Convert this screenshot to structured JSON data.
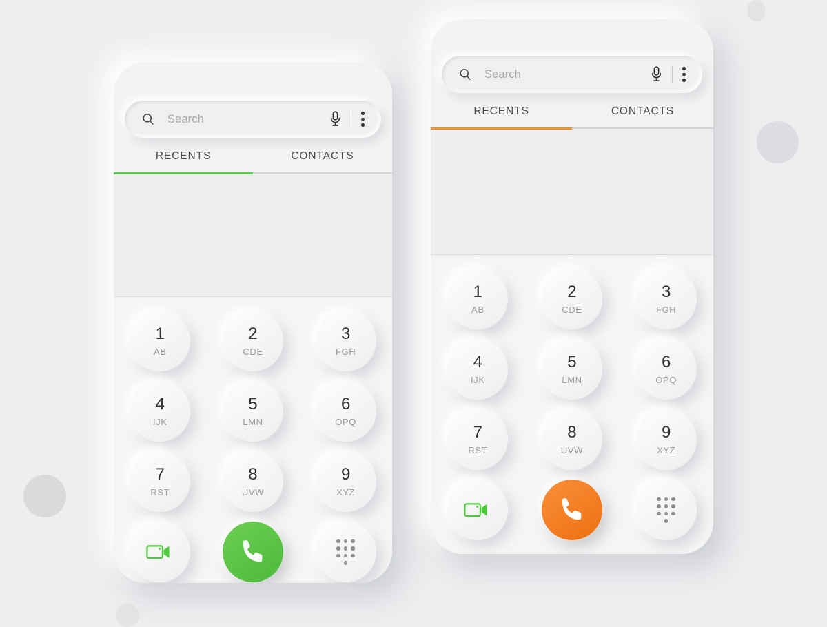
{
  "background": {
    "page_color": "#edeef0",
    "decorations": [
      "circle-top-right",
      "circle-right",
      "circle-bottom-left",
      "circle-bottom"
    ]
  },
  "panels": [
    {
      "id": "left",
      "accent_color": "#5bc74a",
      "call_button_color": "#5bc74a",
      "search": {
        "placeholder": "Search",
        "search_icon": "search-icon",
        "mic_icon": "microphone-icon",
        "menu_icon": "overflow-menu-icon"
      },
      "tabs": [
        {
          "label": "RECENTS",
          "active": true
        },
        {
          "label": "CONTACTS",
          "active": false
        }
      ],
      "keypad": [
        {
          "num": "1",
          "letters": "AB"
        },
        {
          "num": "2",
          "letters": "CDE"
        },
        {
          "num": "3",
          "letters": "FGH"
        },
        {
          "num": "4",
          "letters": "IJK"
        },
        {
          "num": "5",
          "letters": "LMN"
        },
        {
          "num": "6",
          "letters": "OPQ"
        },
        {
          "num": "7",
          "letters": "RST"
        },
        {
          "num": "8",
          "letters": "UVW"
        },
        {
          "num": "9",
          "letters": "XYZ"
        }
      ],
      "actions": {
        "video_icon": "video-camera-icon",
        "call_icon": "phone-handset-icon",
        "keypad_icon": "dialpad-grid-icon",
        "video_color": "#4ecb3a"
      }
    },
    {
      "id": "right",
      "accent_color": "#f0922e",
      "call_button_color": "#f2790f",
      "search": {
        "placeholder": "Search",
        "search_icon": "search-icon",
        "mic_icon": "microphone-icon",
        "menu_icon": "overflow-menu-icon"
      },
      "tabs": [
        {
          "label": "RECENTS",
          "active": true
        },
        {
          "label": "CONTACTS",
          "active": false
        }
      ],
      "keypad": [
        {
          "num": "1",
          "letters": "AB"
        },
        {
          "num": "2",
          "letters": "CDE"
        },
        {
          "num": "3",
          "letters": "FGH"
        },
        {
          "num": "4",
          "letters": "IJK"
        },
        {
          "num": "5",
          "letters": "LMN"
        },
        {
          "num": "6",
          "letters": "OPQ"
        },
        {
          "num": "7",
          "letters": "RST"
        },
        {
          "num": "8",
          "letters": "UVW"
        },
        {
          "num": "9",
          "letters": "XYZ"
        }
      ],
      "actions": {
        "video_icon": "video-camera-icon",
        "call_icon": "phone-handset-icon",
        "keypad_icon": "dialpad-grid-icon",
        "video_color": "#4ecb3a"
      }
    }
  ]
}
